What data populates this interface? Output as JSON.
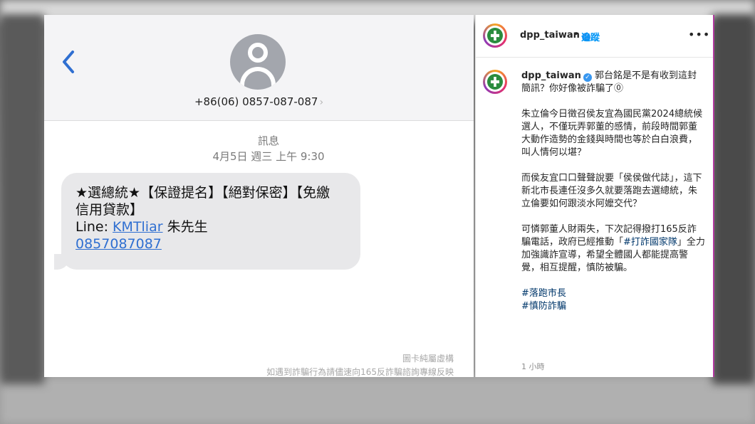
{
  "sms": {
    "back_icon": "chevron-left-icon",
    "avatar_icon": "person-icon",
    "phone_number": "+86(06)  0857-087-087",
    "phone_chevron": "›",
    "messages_label": "訊息",
    "timestamp": "4月5日 週三 上午 9:30",
    "bubble": {
      "line1": "★選總統★【保證提名】【絕對保密】【免繳",
      "line2": "信用貸款】",
      "line3_prefix": "Line: ",
      "line3_link": "KMTliar",
      "line3_suffix": " 朱先生",
      "line4_link": "0857087087"
    },
    "disclaimer_1": "圖卡純屬虛構",
    "disclaimer_2": "如遇到詐騙行為請儘速向165反詐騙諮詢專線反映"
  },
  "instagram": {
    "username": "dpp_taiwan",
    "verified_icon": "verified-badge-icon",
    "separator": "•",
    "follow_label": "追蹤",
    "more_label": "•••",
    "caption_username": "dpp_taiwan",
    "caption_first": "郭台銘是不是有收到這封簡訊？你好像被詐騙了🄋",
    "paragraph_1": "朱立倫今日徵召侯友宜為國民黨2024總統候選人，不僅玩弄郭董的感情，前段時間郭董大動作造勢的金錢與時間也等於白白浪費，叫人情何以堪？",
    "paragraph_2": "而侯友宜口口聲聲說要「侯侯做代誌」，這下新北市長連任沒多久就要落跑去選總統，朱立倫要如何跟淡水阿嬤交代？",
    "paragraph_3_prefix": "可憐郭董人財兩失，下次記得撥打165反詐騙電話，政府已經推動「",
    "paragraph_3_hashtag": "#打詐國家隊",
    "paragraph_3_suffix": "」全力加強識詐宣導，希望全體國人都能提高警覺，相互提醒，慎防被騙。",
    "hashtags": [
      "#落跑市長",
      "#慎防詐騙"
    ],
    "time_ago": "1 小時"
  },
  "colors": {
    "link_blue": "#2f6fd1",
    "follow_blue": "#0095f6",
    "bubble_gray": "#e8e8ea",
    "dpp_green": "#2a8c3e"
  }
}
